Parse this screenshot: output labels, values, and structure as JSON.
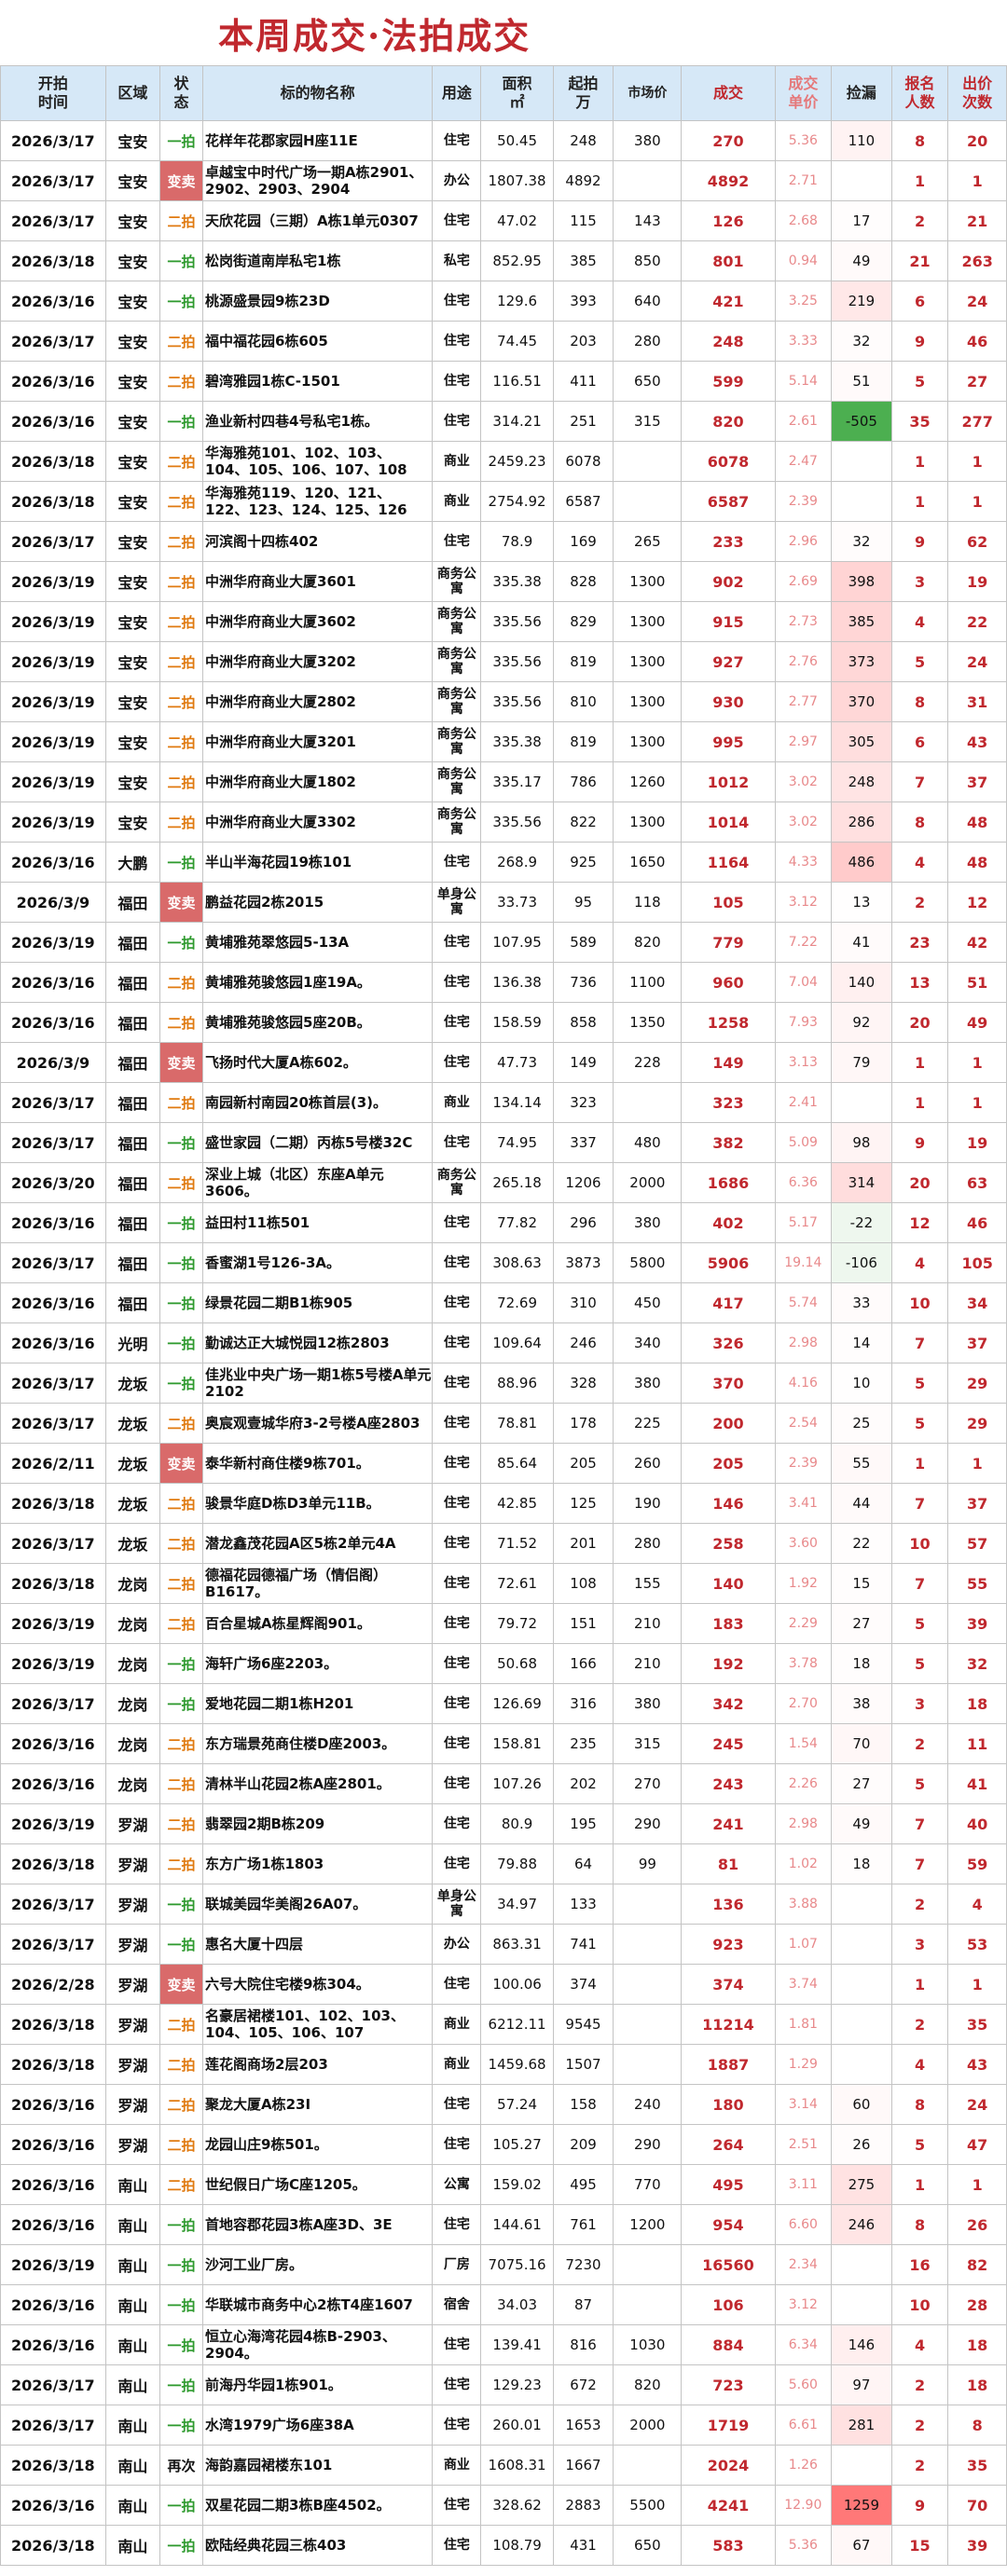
{
  "title": "本周成交·法拍成交",
  "headers": {
    "date": "开拍\n时间",
    "area": "区域",
    "status": "状\n态",
    "name": "标的物名称",
    "use": "用途",
    "size": "面积\n㎡",
    "start": "起拍\n万",
    "market": "市场价",
    "deal": "成交",
    "unit": "成交\n单价",
    "discount": "捡漏",
    "signups": "报名\n人数",
    "bids": "出价\n次数"
  },
  "colors": {
    "title": "#c0282e",
    "header_bg": "#d6e8f7",
    "yipai": "#2e9a2e",
    "erpai": "#e07a10",
    "biannmai": "#d96a6a",
    "discount_max": "#f06a6a",
    "discount_negative": "#4caf50"
  },
  "rows": [
    {
      "date": "2026/3/17",
      "area": "宝安",
      "status": "一拍",
      "name": "花样年花郡家园H座11E",
      "use": "住宅",
      "size": "50.45",
      "start": "248",
      "market": "380",
      "deal": "270",
      "unit": "5.36",
      "discount": "110",
      "signups": "8",
      "bids": "20"
    },
    {
      "date": "2026/3/17",
      "area": "宝安",
      "status": "变卖",
      "name": "卓越宝中时代广场一期A栋2901、2902、2903、2904",
      "use": "办公",
      "size": "1807.38",
      "start": "4892",
      "market": "",
      "deal": "4892",
      "unit": "2.71",
      "discount": "",
      "signups": "1",
      "bids": "1"
    },
    {
      "date": "2026/3/17",
      "area": "宝安",
      "status": "二拍",
      "name": "天欣花园（三期）A栋1单元0307",
      "use": "住宅",
      "size": "47.02",
      "start": "115",
      "market": "143",
      "deal": "126",
      "unit": "2.68",
      "discount": "17",
      "signups": "2",
      "bids": "21"
    },
    {
      "date": "2026/3/18",
      "area": "宝安",
      "status": "一拍",
      "name": "松岗街道南岸私宅1栋",
      "use": "私宅",
      "size": "852.95",
      "start": "385",
      "market": "850",
      "deal": "801",
      "unit": "0.94",
      "discount": "49",
      "signups": "21",
      "bids": "263"
    },
    {
      "date": "2026/3/16",
      "area": "宝安",
      "status": "一拍",
      "name": "桃源盛景园9栋23D",
      "use": "住宅",
      "size": "129.6",
      "start": "393",
      "market": "640",
      "deal": "421",
      "unit": "3.25",
      "discount": "219",
      "signups": "6",
      "bids": "24"
    },
    {
      "date": "2026/3/17",
      "area": "宝安",
      "status": "二拍",
      "name": "福中福花园6栋605",
      "use": "住宅",
      "size": "74.45",
      "start": "203",
      "market": "280",
      "deal": "248",
      "unit": "3.33",
      "discount": "32",
      "signups": "9",
      "bids": "46"
    },
    {
      "date": "2026/3/16",
      "area": "宝安",
      "status": "二拍",
      "name": "碧湾雅园1栋C-1501",
      "use": "住宅",
      "size": "116.51",
      "start": "411",
      "market": "650",
      "deal": "599",
      "unit": "5.14",
      "discount": "51",
      "signups": "5",
      "bids": "27"
    },
    {
      "date": "2026/3/16",
      "area": "宝安",
      "status": "一拍",
      "name": "渔业新村四巷4号私宅1栋。",
      "use": "住宅",
      "size": "314.21",
      "start": "251",
      "market": "315",
      "deal": "820",
      "unit": "2.61",
      "discount": "-505",
      "signups": "35",
      "bids": "277"
    },
    {
      "date": "2026/3/18",
      "area": "宝安",
      "status": "二拍",
      "name": "华海雅苑101、102、103、104、105、106、107、108",
      "use": "商业",
      "size": "2459.23",
      "start": "6078",
      "market": "",
      "deal": "6078",
      "unit": "2.47",
      "discount": "",
      "signups": "1",
      "bids": "1"
    },
    {
      "date": "2026/3/18",
      "area": "宝安",
      "status": "二拍",
      "name": "华海雅苑119、120、121、122、123、124、125、126",
      "use": "商业",
      "size": "2754.92",
      "start": "6587",
      "market": "",
      "deal": "6587",
      "unit": "2.39",
      "discount": "",
      "signups": "1",
      "bids": "1"
    },
    {
      "date": "2026/3/17",
      "area": "宝安",
      "status": "二拍",
      "name": "河滨阁十四栋402",
      "use": "住宅",
      "size": "78.9",
      "start": "169",
      "market": "265",
      "deal": "233",
      "unit": "2.96",
      "discount": "32",
      "signups": "9",
      "bids": "62"
    },
    {
      "date": "2026/3/19",
      "area": "宝安",
      "status": "二拍",
      "name": "中洲华府商业大厦3601",
      "use": "商务公寓",
      "size": "335.38",
      "start": "828",
      "market": "1300",
      "deal": "902",
      "unit": "2.69",
      "discount": "398",
      "signups": "3",
      "bids": "19"
    },
    {
      "date": "2026/3/19",
      "area": "宝安",
      "status": "二拍",
      "name": "中洲华府商业大厦3602",
      "use": "商务公寓",
      "size": "335.56",
      "start": "829",
      "market": "1300",
      "deal": "915",
      "unit": "2.73",
      "discount": "385",
      "signups": "4",
      "bids": "22"
    },
    {
      "date": "2026/3/19",
      "area": "宝安",
      "status": "二拍",
      "name": "中洲华府商业大厦3202",
      "use": "商务公寓",
      "size": "335.56",
      "start": "819",
      "market": "1300",
      "deal": "927",
      "unit": "2.76",
      "discount": "373",
      "signups": "5",
      "bids": "24"
    },
    {
      "date": "2026/3/19",
      "area": "宝安",
      "status": "二拍",
      "name": "中洲华府商业大厦2802",
      "use": "商务公寓",
      "size": "335.56",
      "start": "810",
      "market": "1300",
      "deal": "930",
      "unit": "2.77",
      "discount": "370",
      "signups": "8",
      "bids": "31"
    },
    {
      "date": "2026/3/19",
      "area": "宝安",
      "status": "二拍",
      "name": "中洲华府商业大厦3201",
      "use": "商务公寓",
      "size": "335.38",
      "start": "819",
      "market": "1300",
      "deal": "995",
      "unit": "2.97",
      "discount": "305",
      "signups": "6",
      "bids": "43"
    },
    {
      "date": "2026/3/19",
      "area": "宝安",
      "status": "二拍",
      "name": "中洲华府商业大厦1802",
      "use": "商务公寓",
      "size": "335.17",
      "start": "786",
      "market": "1260",
      "deal": "1012",
      "unit": "3.02",
      "discount": "248",
      "signups": "7",
      "bids": "37"
    },
    {
      "date": "2026/3/19",
      "area": "宝安",
      "status": "二拍",
      "name": "中洲华府商业大厦3302",
      "use": "商务公寓",
      "size": "335.56",
      "start": "822",
      "market": "1300",
      "deal": "1014",
      "unit": "3.02",
      "discount": "286",
      "signups": "8",
      "bids": "48"
    },
    {
      "date": "2026/3/16",
      "area": "大鹏",
      "status": "一拍",
      "name": "半山半海花园19栋101",
      "use": "住宅",
      "size": "268.9",
      "start": "925",
      "market": "1650",
      "deal": "1164",
      "unit": "4.33",
      "discount": "486",
      "signups": "4",
      "bids": "48"
    },
    {
      "date": "2026/3/9",
      "area": "福田",
      "status": "变卖",
      "name": "鹏益花园2栋2015",
      "use": "单身公寓",
      "size": "33.73",
      "start": "95",
      "market": "118",
      "deal": "105",
      "unit": "3.12",
      "discount": "13",
      "signups": "2",
      "bids": "12"
    },
    {
      "date": "2026/3/19",
      "area": "福田",
      "status": "一拍",
      "name": "黄埔雅苑翠悠园5-13A",
      "use": "住宅",
      "size": "107.95",
      "start": "589",
      "market": "820",
      "deal": "779",
      "unit": "7.22",
      "discount": "41",
      "signups": "23",
      "bids": "42"
    },
    {
      "date": "2026/3/16",
      "area": "福田",
      "status": "二拍",
      "name": "黄埔雅苑骏悠园1座19A。",
      "use": "住宅",
      "size": "136.38",
      "start": "736",
      "market": "1100",
      "deal": "960",
      "unit": "7.04",
      "discount": "140",
      "signups": "13",
      "bids": "51"
    },
    {
      "date": "2026/3/16",
      "area": "福田",
      "status": "二拍",
      "name": "黄埔雅苑骏悠园5座20B。",
      "use": "住宅",
      "size": "158.59",
      "start": "858",
      "market": "1350",
      "deal": "1258",
      "unit": "7.93",
      "discount": "92",
      "signups": "20",
      "bids": "49"
    },
    {
      "date": "2026/3/9",
      "area": "福田",
      "status": "变卖",
      "name": "飞扬时代大厦A栋602。",
      "use": "住宅",
      "size": "47.73",
      "start": "149",
      "market": "228",
      "deal": "149",
      "unit": "3.13",
      "discount": "79",
      "signups": "1",
      "bids": "1"
    },
    {
      "date": "2026/3/17",
      "area": "福田",
      "status": "二拍",
      "name": "南园新村南园20栋首层(3)。",
      "use": "商业",
      "size": "134.14",
      "start": "323",
      "market": "",
      "deal": "323",
      "unit": "2.41",
      "discount": "",
      "signups": "1",
      "bids": "1"
    },
    {
      "date": "2026/3/17",
      "area": "福田",
      "status": "一拍",
      "name": "盛世家园（二期）丙栋5号楼32C",
      "use": "住宅",
      "size": "74.95",
      "start": "337",
      "market": "480",
      "deal": "382",
      "unit": "5.09",
      "discount": "98",
      "signups": "9",
      "bids": "19"
    },
    {
      "date": "2026/3/20",
      "area": "福田",
      "status": "二拍",
      "name": "深业上城（北区）东座A单元3606。",
      "use": "商务公寓",
      "size": "265.18",
      "start": "1206",
      "market": "2000",
      "deal": "1686",
      "unit": "6.36",
      "discount": "314",
      "signups": "20",
      "bids": "63"
    },
    {
      "date": "2026/3/16",
      "area": "福田",
      "status": "一拍",
      "name": "益田村11栋501",
      "use": "住宅",
      "size": "77.82",
      "start": "296",
      "market": "380",
      "deal": "402",
      "unit": "5.17",
      "discount": "-22",
      "signups": "12",
      "bids": "46"
    },
    {
      "date": "2026/3/17",
      "area": "福田",
      "status": "一拍",
      "name": "香蜜湖1号126-3A。",
      "use": "住宅",
      "size": "308.63",
      "start": "3873",
      "market": "5800",
      "deal": "5906",
      "unit": "19.14",
      "discount": "-106",
      "signups": "4",
      "bids": "105"
    },
    {
      "date": "2026/3/16",
      "area": "福田",
      "status": "一拍",
      "name": "绿景花园二期B1栋905",
      "use": "住宅",
      "size": "72.69",
      "start": "310",
      "market": "450",
      "deal": "417",
      "unit": "5.74",
      "discount": "33",
      "signups": "10",
      "bids": "34"
    },
    {
      "date": "2026/3/16",
      "area": "光明",
      "status": "一拍",
      "name": "勤诚达正大城悦园12栋2803",
      "use": "住宅",
      "size": "109.64",
      "start": "246",
      "market": "340",
      "deal": "326",
      "unit": "2.98",
      "discount": "14",
      "signups": "7",
      "bids": "37"
    },
    {
      "date": "2026/3/17",
      "area": "龙坂",
      "status": "一拍",
      "name": "佳兆业中央广场一期1栋5号楼A单元2102",
      "use": "住宅",
      "size": "88.96",
      "start": "328",
      "market": "380",
      "deal": "370",
      "unit": "4.16",
      "discount": "10",
      "signups": "5",
      "bids": "29"
    },
    {
      "date": "2026/3/17",
      "area": "龙坂",
      "status": "二拍",
      "name": "奥宸观壹城华府3-2号楼A座2803",
      "use": "住宅",
      "size": "78.81",
      "start": "178",
      "market": "225",
      "deal": "200",
      "unit": "2.54",
      "discount": "25",
      "signups": "5",
      "bids": "29"
    },
    {
      "date": "2026/2/11",
      "area": "龙坂",
      "status": "变卖",
      "name": "泰华新村商住楼9栋701。",
      "use": "住宅",
      "size": "85.64",
      "start": "205",
      "market": "260",
      "deal": "205",
      "unit": "2.39",
      "discount": "55",
      "signups": "1",
      "bids": "1"
    },
    {
      "date": "2026/3/18",
      "area": "龙坂",
      "status": "二拍",
      "name": "骏景华庭D栋D3单元11B。",
      "use": "住宅",
      "size": "42.85",
      "start": "125",
      "market": "190",
      "deal": "146",
      "unit": "3.41",
      "discount": "44",
      "signups": "7",
      "bids": "37"
    },
    {
      "date": "2026/3/17",
      "area": "龙坂",
      "status": "二拍",
      "name": "潜龙鑫茂花园A区5栋2单元4A",
      "use": "住宅",
      "size": "71.52",
      "start": "201",
      "market": "280",
      "deal": "258",
      "unit": "3.60",
      "discount": "22",
      "signups": "10",
      "bids": "57"
    },
    {
      "date": "2026/3/18",
      "area": "龙岗",
      "status": "二拍",
      "name": "德福花园德福广场（情侣阁）B1617。",
      "use": "住宅",
      "size": "72.61",
      "start": "108",
      "market": "155",
      "deal": "140",
      "unit": "1.92",
      "discount": "15",
      "signups": "7",
      "bids": "55"
    },
    {
      "date": "2026/3/19",
      "area": "龙岗",
      "status": "二拍",
      "name": "百合星城A栋星辉阁901。",
      "use": "住宅",
      "size": "79.72",
      "start": "151",
      "market": "210",
      "deal": "183",
      "unit": "2.29",
      "discount": "27",
      "signups": "5",
      "bids": "39"
    },
    {
      "date": "2026/3/19",
      "area": "龙岗",
      "status": "一拍",
      "name": "海轩广场6座2203。",
      "use": "住宅",
      "size": "50.68",
      "start": "166",
      "market": "210",
      "deal": "192",
      "unit": "3.78",
      "discount": "18",
      "signups": "5",
      "bids": "32"
    },
    {
      "date": "2026/3/17",
      "area": "龙岗",
      "status": "一拍",
      "name": "爱地花园二期1栋H201",
      "use": "住宅",
      "size": "126.69",
      "start": "316",
      "market": "380",
      "deal": "342",
      "unit": "2.70",
      "discount": "38",
      "signups": "3",
      "bids": "18"
    },
    {
      "date": "2026/3/16",
      "area": "龙岗",
      "status": "二拍",
      "name": "东方瑞景苑商住楼D座2003。",
      "use": "住宅",
      "size": "158.81",
      "start": "235",
      "market": "315",
      "deal": "245",
      "unit": "1.54",
      "discount": "70",
      "signups": "2",
      "bids": "11"
    },
    {
      "date": "2026/3/16",
      "area": "龙岗",
      "status": "二拍",
      "name": "清林半山花园2栋A座2801。",
      "use": "住宅",
      "size": "107.26",
      "start": "202",
      "market": "270",
      "deal": "243",
      "unit": "2.26",
      "discount": "27",
      "signups": "5",
      "bids": "41"
    },
    {
      "date": "2026/3/19",
      "area": "罗湖",
      "status": "二拍",
      "name": "翡翠园2期B栋209",
      "use": "住宅",
      "size": "80.9",
      "start": "195",
      "market": "290",
      "deal": "241",
      "unit": "2.98",
      "discount": "49",
      "signups": "7",
      "bids": "40"
    },
    {
      "date": "2026/3/18",
      "area": "罗湖",
      "status": "二拍",
      "name": "东方广场1栋1803",
      "use": "住宅",
      "size": "79.88",
      "start": "64",
      "market": "99",
      "deal": "81",
      "unit": "1.02",
      "discount": "18",
      "signups": "7",
      "bids": "59"
    },
    {
      "date": "2026/3/17",
      "area": "罗湖",
      "status": "一拍",
      "name": "联城美园华美阁26A07。",
      "use": "单身公寓",
      "size": "34.97",
      "start": "133",
      "market": "",
      "deal": "136",
      "unit": "3.88",
      "discount": "",
      "signups": "2",
      "bids": "4"
    },
    {
      "date": "2026/3/17",
      "area": "罗湖",
      "status": "一拍",
      "name": "惠名大厦十四层",
      "use": "办公",
      "size": "863.31",
      "start": "741",
      "market": "",
      "deal": "923",
      "unit": "1.07",
      "discount": "",
      "signups": "3",
      "bids": "53"
    },
    {
      "date": "2026/2/28",
      "area": "罗湖",
      "status": "变卖",
      "name": "六号大院住宅楼9栋304。",
      "use": "住宅",
      "size": "100.06",
      "start": "374",
      "market": "",
      "deal": "374",
      "unit": "3.74",
      "discount": "",
      "signups": "1",
      "bids": "1"
    },
    {
      "date": "2026/3/18",
      "area": "罗湖",
      "status": "二拍",
      "name": "名豪居裙楼101、102、103、104、105、106、107",
      "use": "商业",
      "size": "6212.11",
      "start": "9545",
      "market": "",
      "deal": "11214",
      "unit": "1.81",
      "discount": "",
      "signups": "2",
      "bids": "35"
    },
    {
      "date": "2026/3/18",
      "area": "罗湖",
      "status": "二拍",
      "name": "莲花阁商场2层203",
      "use": "商业",
      "size": "1459.68",
      "start": "1507",
      "market": "",
      "deal": "1887",
      "unit": "1.29",
      "discount": "",
      "signups": "4",
      "bids": "43"
    },
    {
      "date": "2026/3/16",
      "area": "罗湖",
      "status": "二拍",
      "name": "聚龙大厦A栋23I",
      "use": "住宅",
      "size": "57.24",
      "start": "158",
      "market": "240",
      "deal": "180",
      "unit": "3.14",
      "discount": "60",
      "signups": "8",
      "bids": "24"
    },
    {
      "date": "2026/3/16",
      "area": "罗湖",
      "status": "二拍",
      "name": "龙园山庄9栋501。",
      "use": "住宅",
      "size": "105.27",
      "start": "209",
      "market": "290",
      "deal": "264",
      "unit": "2.51",
      "discount": "26",
      "signups": "5",
      "bids": "47"
    },
    {
      "date": "2026/3/16",
      "area": "南山",
      "status": "二拍",
      "name": "世纪假日广场C座1205。",
      "use": "公寓",
      "size": "159.02",
      "start": "495",
      "market": "770",
      "deal": "495",
      "unit": "3.11",
      "discount": "275",
      "signups": "1",
      "bids": "1"
    },
    {
      "date": "2026/3/16",
      "area": "南山",
      "status": "一拍",
      "name": "首地容郡花园3栋A座3D、3E",
      "use": "住宅",
      "size": "144.61",
      "start": "761",
      "market": "1200",
      "deal": "954",
      "unit": "6.60",
      "discount": "246",
      "signups": "8",
      "bids": "26"
    },
    {
      "date": "2026/3/19",
      "area": "南山",
      "status": "一拍",
      "name": "沙河工业厂房。",
      "use": "厂房",
      "size": "7075.16",
      "start": "7230",
      "market": "",
      "deal": "16560",
      "unit": "2.34",
      "discount": "",
      "signups": "16",
      "bids": "82"
    },
    {
      "date": "2026/3/16",
      "area": "南山",
      "status": "一拍",
      "name": "华联城市商务中心2栋T4座1607",
      "use": "宿舍",
      "size": "34.03",
      "start": "87",
      "market": "",
      "deal": "106",
      "unit": "3.12",
      "discount": "",
      "signups": "10",
      "bids": "28"
    },
    {
      "date": "2026/3/16",
      "area": "南山",
      "status": "一拍",
      "name": "恒立心海湾花园4栋B-2903、2904。",
      "use": "住宅",
      "size": "139.41",
      "start": "816",
      "market": "1030",
      "deal": "884",
      "unit": "6.34",
      "discount": "146",
      "signups": "4",
      "bids": "18"
    },
    {
      "date": "2026/3/17",
      "area": "南山",
      "status": "一拍",
      "name": "前海丹华园1栋901。",
      "use": "住宅",
      "size": "129.23",
      "start": "672",
      "market": "820",
      "deal": "723",
      "unit": "5.60",
      "discount": "97",
      "signups": "2",
      "bids": "18"
    },
    {
      "date": "2026/3/17",
      "area": "南山",
      "status": "一拍",
      "name": "水湾1979广场6座38A",
      "use": "住宅",
      "size": "260.01",
      "start": "1653",
      "market": "2000",
      "deal": "1719",
      "unit": "6.61",
      "discount": "281",
      "signups": "2",
      "bids": "8"
    },
    {
      "date": "2026/3/18",
      "area": "南山",
      "status": "再次",
      "name": "海韵嘉园裙楼东101",
      "use": "商业",
      "size": "1608.31",
      "start": "1667",
      "market": "",
      "deal": "2024",
      "unit": "1.26",
      "discount": "",
      "signups": "2",
      "bids": "35"
    },
    {
      "date": "2026/3/16",
      "area": "南山",
      "status": "一拍",
      "name": "双星花园二期3栋B座4502。",
      "use": "住宅",
      "size": "328.62",
      "start": "2883",
      "market": "5500",
      "deal": "4241",
      "unit": "12.90",
      "discount": "1259",
      "signups": "9",
      "bids": "70"
    },
    {
      "date": "2026/3/18",
      "area": "南山",
      "status": "一拍",
      "name": "欧陆经典花园三栋403",
      "use": "住宅",
      "size": "108.79",
      "start": "431",
      "market": "650",
      "deal": "583",
      "unit": "5.36",
      "discount": "67",
      "signups": "15",
      "bids": "39"
    }
  ]
}
